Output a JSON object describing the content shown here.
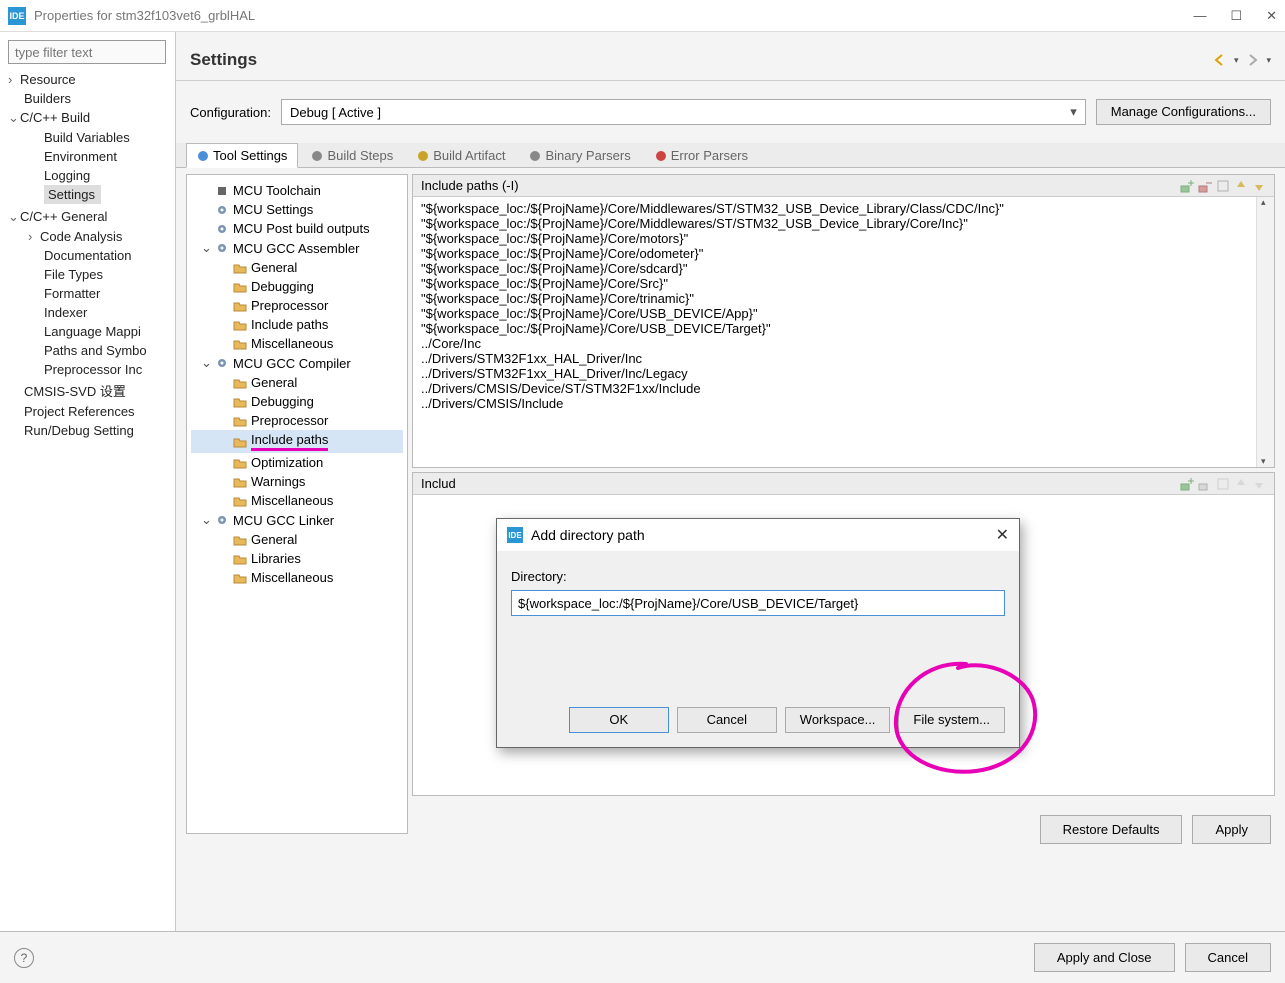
{
  "window": {
    "title": "Properties for stm32f103vet6_grblHAL",
    "app_icon_text": "IDE"
  },
  "sidebar": {
    "filter_placeholder": "type filter text",
    "items": [
      {
        "label": "Resource",
        "arrow": "›"
      },
      {
        "label": "Builders"
      },
      {
        "label": "C/C++ Build",
        "arrow": "⌄",
        "children": [
          {
            "label": "Build Variables"
          },
          {
            "label": "Environment"
          },
          {
            "label": "Logging"
          },
          {
            "label": "Settings",
            "selected": true
          }
        ]
      },
      {
        "label": "C/C++ General",
        "arrow": "⌄",
        "children": [
          {
            "label": "Code Analysis",
            "arrow": "›"
          },
          {
            "label": "Documentation"
          },
          {
            "label": "File Types"
          },
          {
            "label": "Formatter"
          },
          {
            "label": "Indexer"
          },
          {
            "label": "Language Mappi"
          },
          {
            "label": "Paths and Symbo"
          },
          {
            "label": "Preprocessor Inc"
          }
        ]
      },
      {
        "label": "CMSIS-SVD 设置"
      },
      {
        "label": "Project References"
      },
      {
        "label": "Run/Debug Setting"
      }
    ]
  },
  "content": {
    "heading": "Settings",
    "configuration_label": "Configuration:",
    "configuration_value": "Debug  [ Active ]",
    "manage_btn": "Manage Configurations...",
    "tabs": [
      "Tool Settings",
      "Build Steps",
      "Build Artifact",
      "Binary Parsers",
      "Error Parsers"
    ]
  },
  "tool_tree": [
    {
      "label": "MCU Toolchain",
      "type": "plain"
    },
    {
      "label": "MCU Settings",
      "type": "gear"
    },
    {
      "label": "MCU Post build outputs",
      "type": "gear"
    },
    {
      "label": "MCU GCC Assembler",
      "type": "group",
      "children": [
        {
          "label": "General"
        },
        {
          "label": "Debugging"
        },
        {
          "label": "Preprocessor"
        },
        {
          "label": "Include paths"
        },
        {
          "label": "Miscellaneous"
        }
      ]
    },
    {
      "label": "MCU GCC Compiler",
      "type": "group",
      "children": [
        {
          "label": "General"
        },
        {
          "label": "Debugging"
        },
        {
          "label": "Preprocessor"
        },
        {
          "label": "Include paths",
          "selected": true,
          "underline": true
        },
        {
          "label": "Optimization"
        },
        {
          "label": "Warnings"
        },
        {
          "label": "Miscellaneous"
        }
      ]
    },
    {
      "label": "MCU GCC Linker",
      "type": "group",
      "children": [
        {
          "label": "General"
        },
        {
          "label": "Libraries"
        },
        {
          "label": "Miscellaneous"
        }
      ]
    }
  ],
  "pane1": {
    "title": "Include paths (-I)",
    "lines": [
      "\"${workspace_loc:/${ProjName}/Core/Middlewares/ST/STM32_USB_Device_Library/Class/CDC/Inc}\"",
      "\"${workspace_loc:/${ProjName}/Core/Middlewares/ST/STM32_USB_Device_Library/Core/Inc}\"",
      "\"${workspace_loc:/${ProjName}/Core/motors}\"",
      "\"${workspace_loc:/${ProjName}/Core/odometer}\"",
      "\"${workspace_loc:/${ProjName}/Core/sdcard}\"",
      "\"${workspace_loc:/${ProjName}/Core/Src}\"",
      "\"${workspace_loc:/${ProjName}/Core/trinamic}\"",
      "\"${workspace_loc:/${ProjName}/Core/USB_DEVICE/App}\"",
      "\"${workspace_loc:/${ProjName}/Core/USB_DEVICE/Target}\"",
      "../Core/Inc",
      "../Drivers/STM32F1xx_HAL_Driver/Inc",
      "../Drivers/STM32F1xx_HAL_Driver/Inc/Legacy",
      "../Drivers/CMSIS/Device/ST/STM32F1xx/Include",
      "../Drivers/CMSIS/Include"
    ]
  },
  "pane2": {
    "title": "Includ"
  },
  "bottom": {
    "restore": "Restore Defaults",
    "apply": "Apply",
    "apply_close": "Apply and Close",
    "cancel": "Cancel"
  },
  "dialog": {
    "title": "Add directory path",
    "app_icon_text": "IDE",
    "directory_label": "Directory:",
    "directory_value": "${workspace_loc:/${ProjName}/Core/USB_DEVICE/Target}",
    "ok": "OK",
    "cancel": "Cancel",
    "workspace": "Workspace...",
    "filesystem": "File system..."
  }
}
